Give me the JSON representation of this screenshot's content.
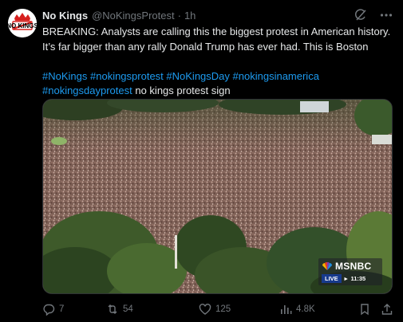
{
  "tweet": {
    "author_name": "No Kings",
    "handle": "@NoKingsProtest",
    "separator": "·",
    "time": "1h",
    "avatar_text": "NO KINGS",
    "text_line1": "BREAKING: Analysts are calling this the biggest protest in American history.",
    "text_line2": "It’s far bigger than any rally Donald Trump has ever had. This is Boston",
    "hashtags": {
      "h1": "#NoKings",
      "h2": "#nokingsprotest",
      "h3": "#NoKingsDay",
      "h4": "#nokingsinamerica",
      "h5": "#nokingsdayprotest"
    },
    "trailing_text": " no kings protest sign"
  },
  "media": {
    "broadcaster": "MSNBC",
    "live_label": "LIVE",
    "live_time": "11:35"
  },
  "actions": {
    "replies": "7",
    "reposts": "54",
    "likes": "125",
    "views": "4.8K"
  },
  "icons": {
    "grok": "grok-icon",
    "more": "more-icon",
    "reply": "reply-icon",
    "repost": "repost-icon",
    "like": "like-icon",
    "views": "views-icon",
    "bookmark": "bookmark-icon",
    "share": "share-icon"
  },
  "colors": {
    "background": "#000000",
    "text": "#e7e9ea",
    "muted": "#71767b",
    "link": "#1d9bf0"
  }
}
